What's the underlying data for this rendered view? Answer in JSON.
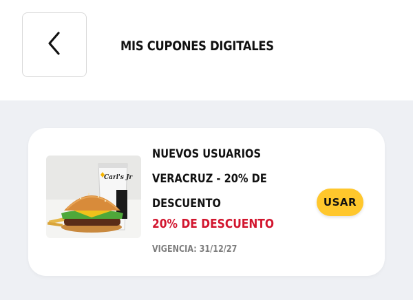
{
  "header": {
    "back_icon": "chevron-left-icon",
    "title": "MIS CUPONES DIGITALES"
  },
  "coupons": [
    {
      "name_lines": [
        "NUEVOS USUARIOS",
        "VERACRUZ - 20% DE",
        "DESCUENTO"
      ],
      "discount": "20% DE DESCUENTO",
      "validity": "VIGENCIA: 31/12/27",
      "action_label": "USAR",
      "image_logo_text": "Carl's Jr"
    }
  ],
  "colors": {
    "background": "#eef0f4",
    "discount": "#d2152e",
    "button": "#ffc72c"
  }
}
